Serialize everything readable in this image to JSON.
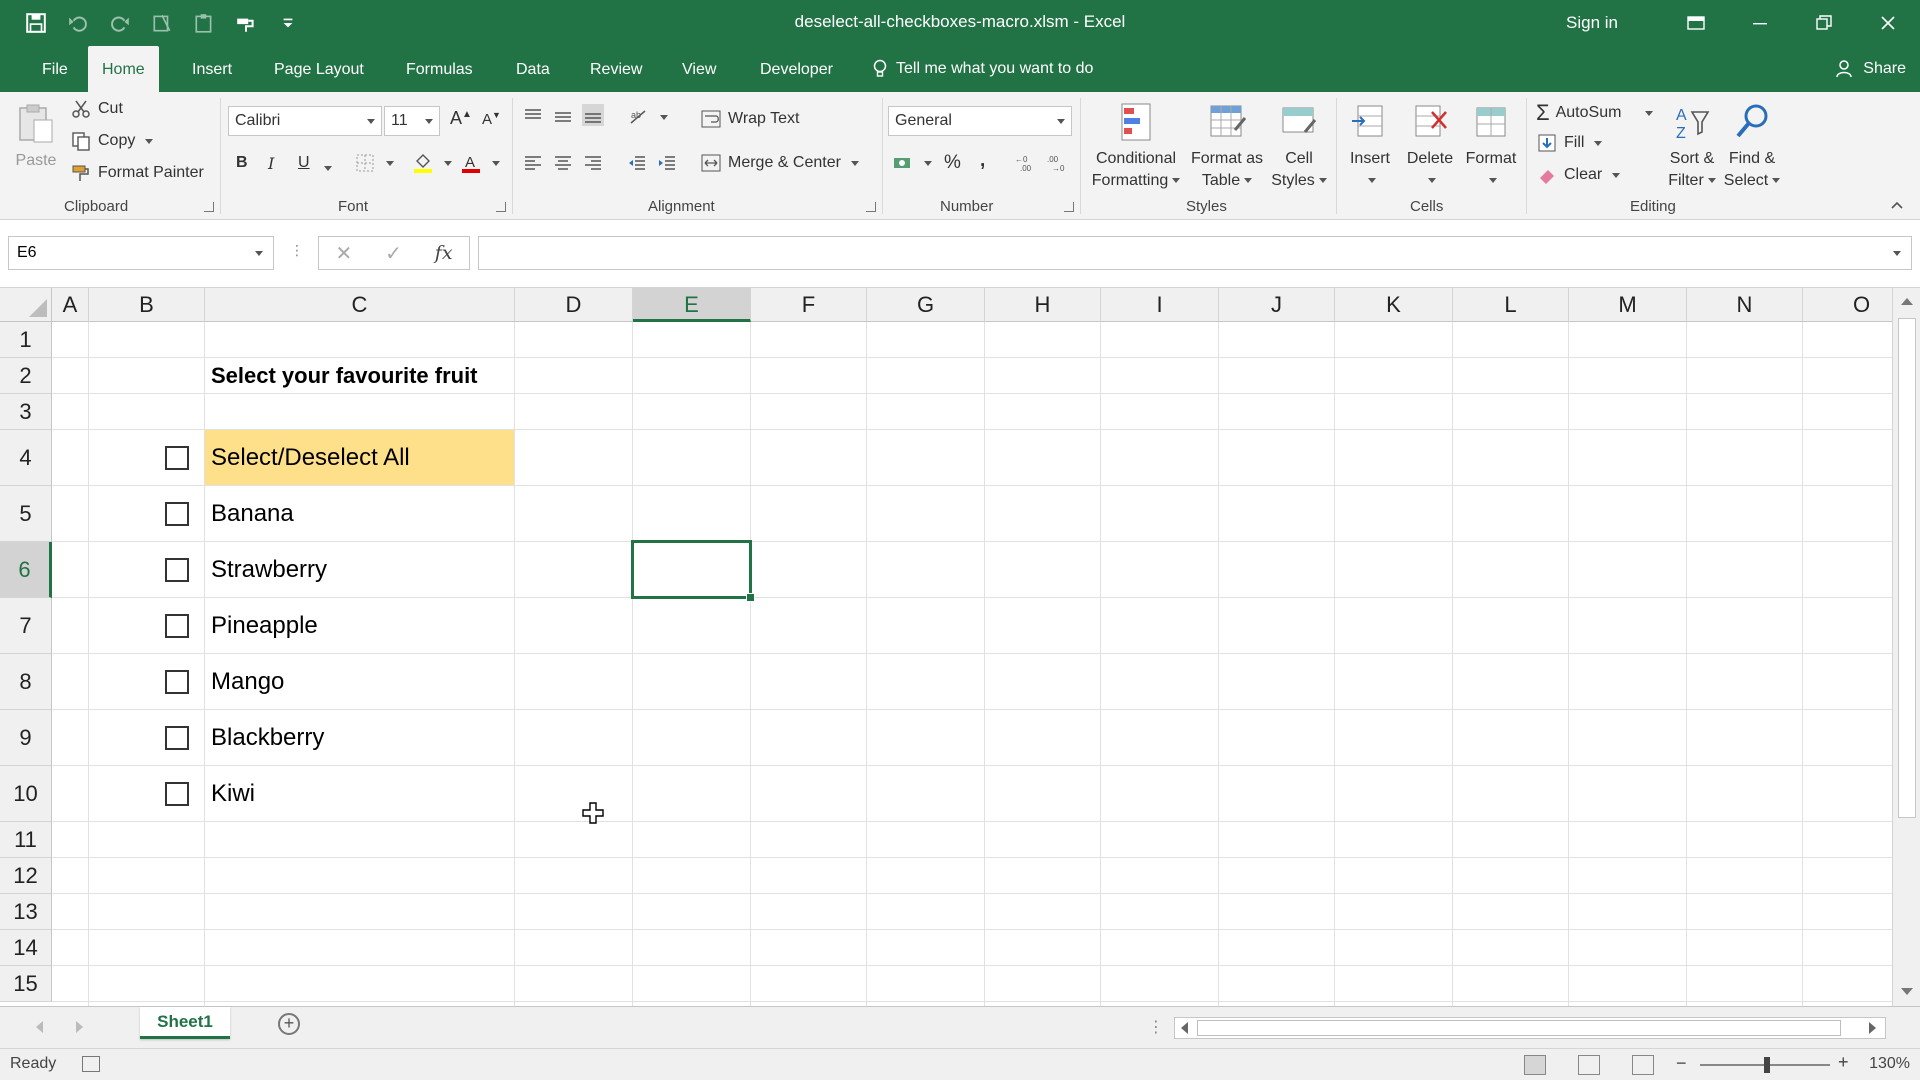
{
  "window": {
    "title": "deselect-all-checkboxes-macro.xlsm  -  Excel",
    "sign_in": "Sign in"
  },
  "tabs": [
    {
      "label": "File",
      "active": false
    },
    {
      "label": "Home",
      "active": true
    },
    {
      "label": "Insert",
      "active": false
    },
    {
      "label": "Page Layout",
      "active": false
    },
    {
      "label": "Formulas",
      "active": false
    },
    {
      "label": "Data",
      "active": false
    },
    {
      "label": "Review",
      "active": false
    },
    {
      "label": "View",
      "active": false
    },
    {
      "label": "Developer",
      "active": false
    }
  ],
  "tell_me": "Tell me what you want to do",
  "share": "Share",
  "ribbon": {
    "clipboard": {
      "group": "Clipboard",
      "paste": "Paste",
      "cut": "Cut",
      "copy": "Copy",
      "format_painter": "Format Painter"
    },
    "font": {
      "group": "Font",
      "font_name": "Calibri",
      "font_size": "11",
      "bold": "B",
      "italic": "I",
      "underline": "U"
    },
    "alignment": {
      "group": "Alignment",
      "wrap_text": "Wrap Text",
      "merge_center": "Merge & Center"
    },
    "number": {
      "group": "Number",
      "format": "General",
      "percent": "%",
      "comma": ","
    },
    "styles": {
      "group": "Styles",
      "conditional_formatting": [
        "Conditional",
        "Formatting"
      ],
      "format_as_table": [
        "Format as",
        "Table"
      ],
      "cell_styles": [
        "Cell",
        "Styles"
      ]
    },
    "cells": {
      "group": "Cells",
      "insert": "Insert",
      "delete": "Delete",
      "format": "Format"
    },
    "editing": {
      "group": "Editing",
      "autosum": "AutoSum",
      "fill": "Fill",
      "clear": "Clear",
      "sort_filter": [
        "Sort &",
        "Filter"
      ],
      "find_select": [
        "Find &",
        "Select"
      ]
    }
  },
  "formula_bar": {
    "name_box": "E6",
    "fx": "fx",
    "value": ""
  },
  "columns": [
    "A",
    "B",
    "C",
    "D",
    "E",
    "F",
    "G",
    "H",
    "I",
    "J",
    "K",
    "L",
    "M",
    "N",
    "O"
  ],
  "selected_column": "E",
  "rows": [
    "1",
    "2",
    "3",
    "4",
    "5",
    "6",
    "7",
    "8",
    "9",
    "10",
    "11",
    "12",
    "13",
    "14",
    "15"
  ],
  "selected_row": "6",
  "sheet": {
    "heading": "Select your favourite fruit",
    "select_all": "Select/Deselect All",
    "fruits": [
      "Banana",
      "Strawberry",
      "Pineapple",
      "Mango",
      "Blackberry",
      "Kiwi"
    ],
    "highlight_color": "#ffe08a"
  },
  "sheet_tabs": [
    {
      "label": "Sheet1",
      "active": true
    }
  ],
  "status": {
    "ready": "Ready",
    "zoom": "130%"
  },
  "colors": {
    "accent": "#217346"
  }
}
